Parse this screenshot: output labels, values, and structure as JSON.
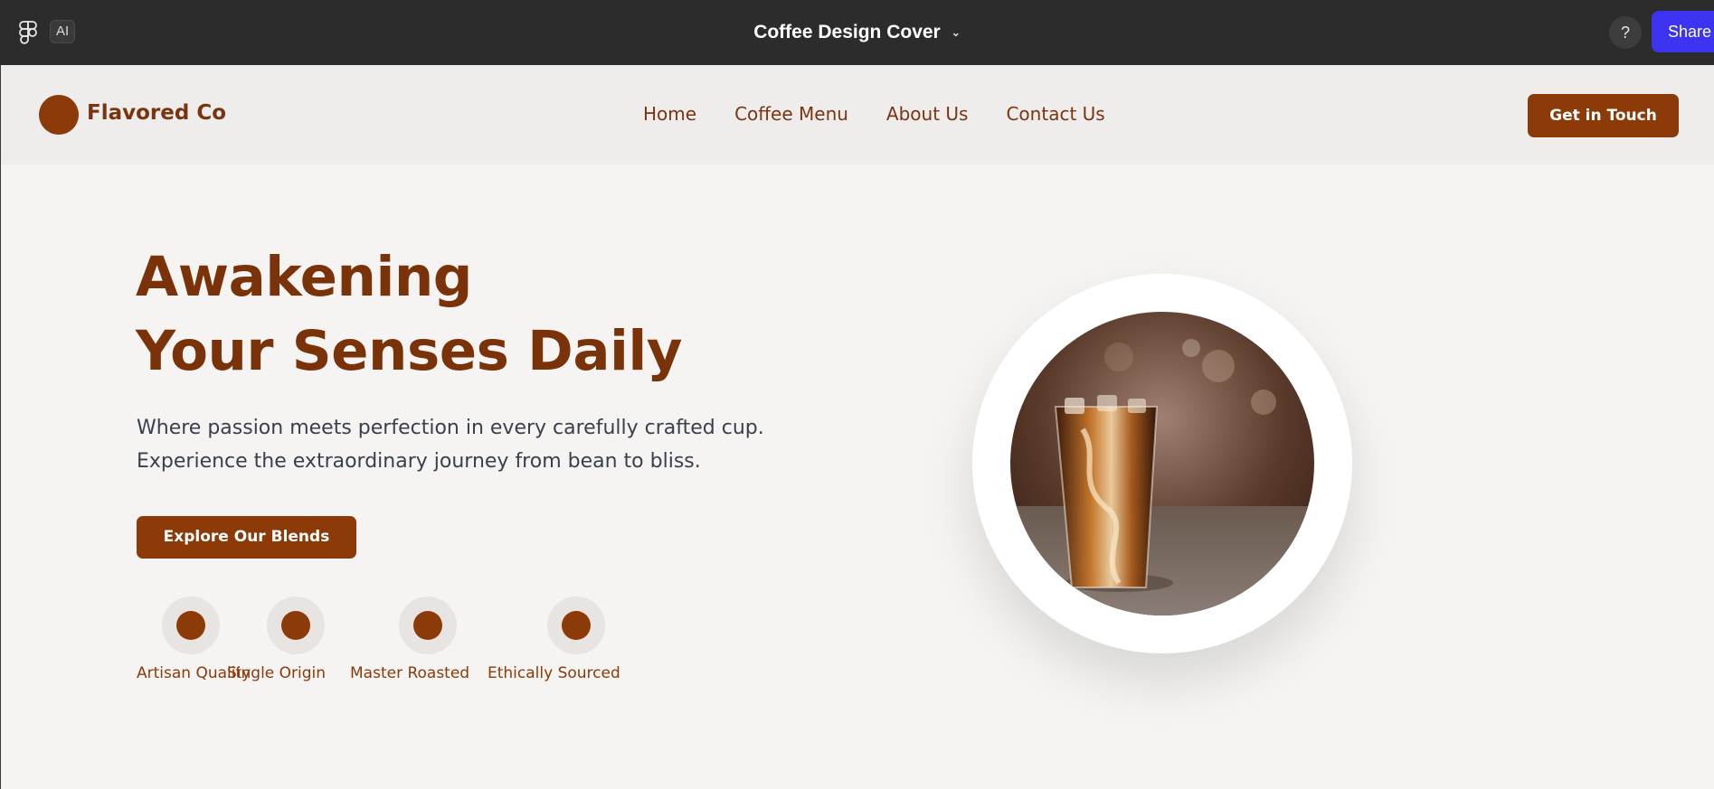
{
  "app": {
    "title": "Coffee Design Cover",
    "ai_label": "AI",
    "help_label": "?",
    "share_label": "Share"
  },
  "nav": {
    "brand": "Flavored Co",
    "links": [
      "Home",
      "Coffee Menu",
      "About Us",
      "Contact Us"
    ],
    "cta": "Get in Touch"
  },
  "hero": {
    "title_line1": "Awakening",
    "title_line2": "Your Senses Daily",
    "subtitle_line1": "Where passion meets perfection in every carefully crafted cup.",
    "subtitle_line2": "Experience the extraordinary journey from bean to bliss.",
    "button": "Explore Our Blends",
    "features": [
      "Artisan Quality",
      "Single Origin",
      "Master Roasted",
      "Ethically Sourced"
    ]
  },
  "colors": {
    "brand": "#8b3a08",
    "topbar": "#2c2c2c",
    "share": "#3c34f0",
    "page_bg": "#f5f4f2",
    "nav_bg": "#efecec"
  }
}
